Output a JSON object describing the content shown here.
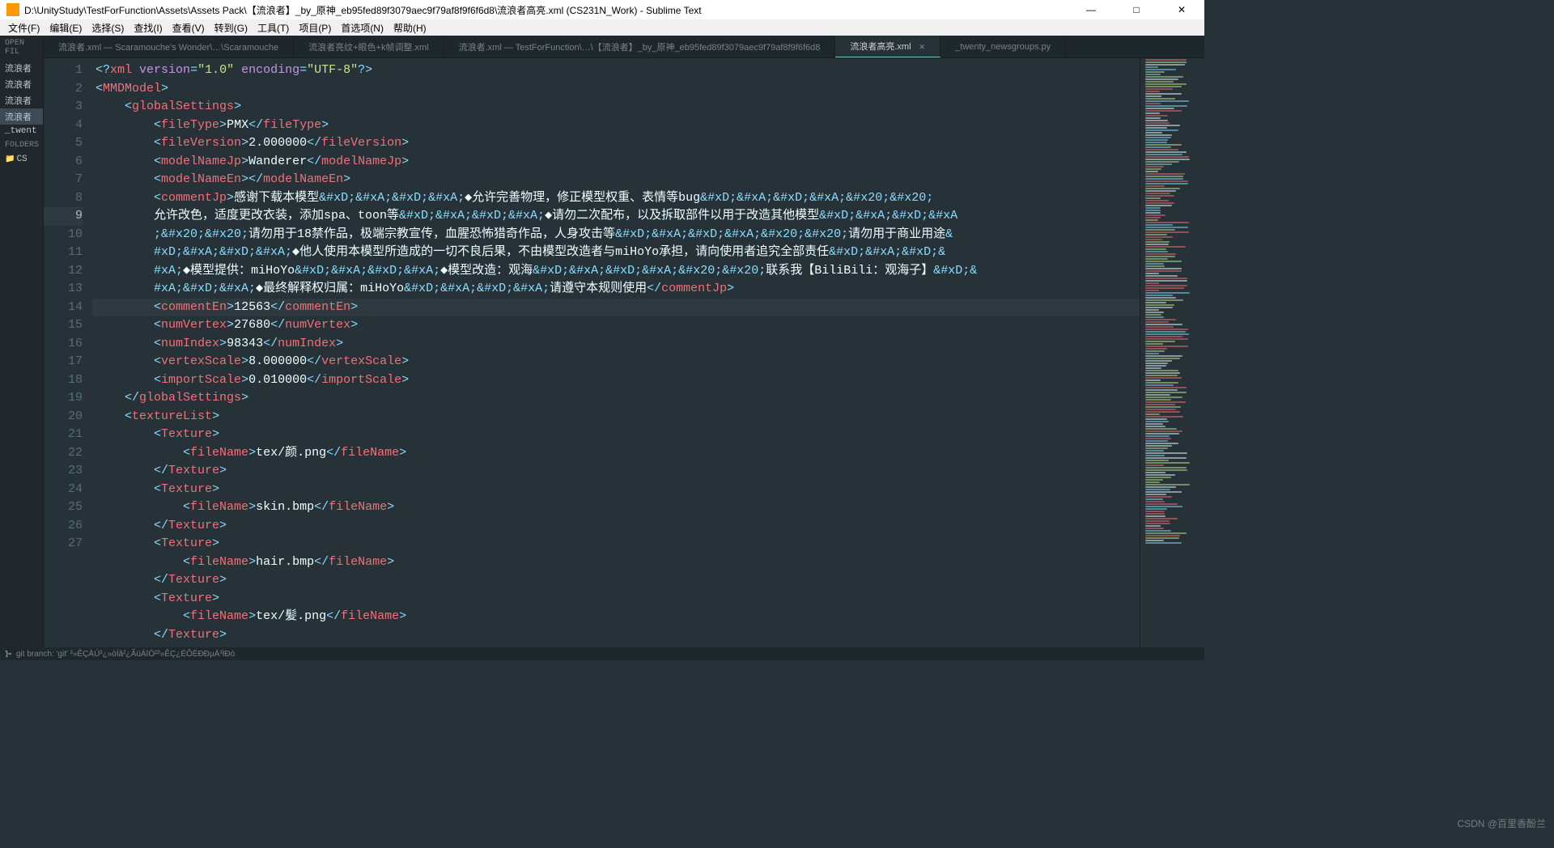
{
  "window": {
    "title": "D:\\UnityStudy\\TestForFunction\\Assets\\Assets Pack\\【流浪者】_by_原神_eb95fed89f3079aec9f79af8f9f6f6d8\\流浪者高亮.xml (CS231N_Work) - Sublime Text"
  },
  "menus": [
    "文件(F)",
    "编辑(E)",
    "选择(S)",
    "查找(I)",
    "查看(V)",
    "转到(G)",
    "工具(T)",
    "项目(P)",
    "首选项(N)",
    "帮助(H)"
  ],
  "sidebar": {
    "open_files_label": "OPEN FIL",
    "open_files": [
      "流浪者",
      "流浪者",
      "流浪者",
      "流浪者",
      "_twent"
    ],
    "folders_label": "FOLDERS",
    "folders": [
      "CS"
    ]
  },
  "tabs": [
    {
      "label": "流浪者.xml — Scaramouche's Wonder\\…\\Scaramouche",
      "active": false
    },
    {
      "label": "流浪者亮纹+眼色+k帧调整.xml",
      "active": false
    },
    {
      "label": "流浪者.xml — TestForFunction\\…\\【流浪者】_by_原神_eb95fed89f3079aec9f79af8f9f6f6d8",
      "active": false
    },
    {
      "label": "流浪者高亮.xml",
      "active": true,
      "close": "×"
    },
    {
      "label": "_twenty_newsgroups.py",
      "active": false
    }
  ],
  "editor": {
    "current_line": 9,
    "lines": [
      {
        "n": 1,
        "html": "<span class='p'>&lt;?</span><span class='pitag'>xml</span> <span class='attr'>version</span><span class='p'>=</span><span class='str'>\"1.0\"</span> <span class='attr'>encoding</span><span class='p'>=</span><span class='str'>\"UTF-8\"</span><span class='p'>?&gt;</span>"
      },
      {
        "n": 2,
        "html": "<span class='p'>&lt;</span><span class='tag'>MMDModel</span><span class='p'>&gt;</span>"
      },
      {
        "n": 3,
        "html": "    <span class='p'>&lt;</span><span class='tag'>globalSettings</span><span class='p'>&gt;</span>"
      },
      {
        "n": 4,
        "html": "        <span class='p'>&lt;</span><span class='tag'>fileType</span><span class='p'>&gt;</span><span class='txt'>PMX</span><span class='p'>&lt;/</span><span class='tag'>fileType</span><span class='p'>&gt;</span>"
      },
      {
        "n": 5,
        "html": "        <span class='p'>&lt;</span><span class='tag'>fileVersion</span><span class='p'>&gt;</span><span class='txt'>2.000000</span><span class='p'>&lt;/</span><span class='tag'>fileVersion</span><span class='p'>&gt;</span>"
      },
      {
        "n": 6,
        "html": "        <span class='p'>&lt;</span><span class='tag'>modelNameJp</span><span class='p'>&gt;</span><span class='txt'>Wanderer</span><span class='p'>&lt;/</span><span class='tag'>modelNameJp</span><span class='p'>&gt;</span>"
      },
      {
        "n": 7,
        "html": "        <span class='p'>&lt;</span><span class='tag'>modelNameEn</span><span class='p'>&gt;&lt;/</span><span class='tag'>modelNameEn</span><span class='p'>&gt;</span>"
      },
      {
        "n": 8,
        "html": "        <span class='p'>&lt;</span><span class='tag'>commentJp</span><span class='p'>&gt;</span><span class='txt'>感谢下载本模型</span><span class='ent'>&amp;#xD;&amp;#xA;&amp;#xD;&amp;#xA;</span><span class='txt'>◆允许完善物理，修正模型权重、表情等bug</span><span class='ent'>&amp;#xD;&amp;#xA;&amp;#xD;&amp;#xA;&amp;#x20;&amp;#x20;</span>\n        <span class='txt'>允许改色，适度更改衣装，添加spa、toon等</span><span class='ent'>&amp;#xD;&amp;#xA;&amp;#xD;&amp;#xA;</span><span class='txt'>◆请勿二次配布，以及拆取部件以用于改造其他模型</span><span class='ent'>&amp;#xD;&amp;#xA;&amp;#xD;&amp;#xA</span>\n        <span class='ent'>;&amp;#x20;&amp;#x20;</span><span class='txt'>请勿用于18禁作品，极端宗教宣传，血腥恐怖猎奇作品，人身攻击等</span><span class='ent'>&amp;#xD;&amp;#xA;&amp;#xD;&amp;#xA;&amp;#x20;&amp;#x20;</span><span class='txt'>请勿用于商业用途</span><span class='ent'>&amp;</span>\n        <span class='ent'>#xD;&amp;#xA;&amp;#xD;&amp;#xA;</span><span class='txt'>◆他人使用本模型所造成的一切不良后果，不由模型改造者与miHoYo承担，请向使用者追究全部责任</span><span class='ent'>&amp;#xD;&amp;#xA;&amp;#xD;&amp;</span>\n        <span class='ent'>#xA;</span><span class='txt'>◆模型提供：miHoYo</span><span class='ent'>&amp;#xD;&amp;#xA;&amp;#xD;&amp;#xA;</span><span class='txt'>◆模型改造：观海</span><span class='ent'>&amp;#xD;&amp;#xA;&amp;#xD;&amp;#xA;&amp;#x20;&amp;#x20;</span><span class='txt'>联系我【BiliBili：观海子】</span><span class='ent'>&amp;#xD;&amp;</span>\n        <span class='ent'>#xA;&amp;#xD;&amp;#xA;</span><span class='txt'>◆最终解释权归属：miHoYo</span><span class='ent'>&amp;#xD;&amp;#xA;&amp;#xD;&amp;#xA;</span><span class='txt'>请遵守本规则使用</span><span class='p'>&lt;/</span><span class='tag'>commentJp</span><span class='p'>&gt;</span>"
      },
      {
        "n": 9,
        "html": "        <span class='p'>&lt;</span><span class='tag'>commentEn</span><span class='p'>&gt;</span><span class='txt'>12563</span><span class='p'>&lt;/</span><span class='tag'>commentEn</span><span class='p'>&gt;</span>"
      },
      {
        "n": 10,
        "html": "        <span class='p'>&lt;</span><span class='tag'>numVertex</span><span class='p'>&gt;</span><span class='txt'>27680</span><span class='p'>&lt;/</span><span class='tag'>numVertex</span><span class='p'>&gt;</span>"
      },
      {
        "n": 11,
        "html": "        <span class='p'>&lt;</span><span class='tag'>numIndex</span><span class='p'>&gt;</span><span class='txt'>98343</span><span class='p'>&lt;/</span><span class='tag'>numIndex</span><span class='p'>&gt;</span>"
      },
      {
        "n": 12,
        "html": "        <span class='p'>&lt;</span><span class='tag'>vertexScale</span><span class='p'>&gt;</span><span class='txt'>8.000000</span><span class='p'>&lt;/</span><span class='tag'>vertexScale</span><span class='p'>&gt;</span>"
      },
      {
        "n": 13,
        "html": "        <span class='p'>&lt;</span><span class='tag'>importScale</span><span class='p'>&gt;</span><span class='txt'>0.010000</span><span class='p'>&lt;/</span><span class='tag'>importScale</span><span class='p'>&gt;</span>"
      },
      {
        "n": 14,
        "html": "    <span class='p'>&lt;/</span><span class='tag'>globalSettings</span><span class='p'>&gt;</span>"
      },
      {
        "n": 15,
        "html": "    <span class='p'>&lt;</span><span class='tag'>textureList</span><span class='p'>&gt;</span>"
      },
      {
        "n": 16,
        "html": "        <span class='p'>&lt;</span><span class='tag'>Texture</span><span class='p'>&gt;</span>"
      },
      {
        "n": 17,
        "html": "            <span class='p'>&lt;</span><span class='tag'>fileName</span><span class='p'>&gt;</span><span class='txt'>tex/颜.png</span><span class='p'>&lt;/</span><span class='tag'>fileName</span><span class='p'>&gt;</span>"
      },
      {
        "n": 18,
        "html": "        <span class='p'>&lt;/</span><span class='tag'>Texture</span><span class='p'>&gt;</span>"
      },
      {
        "n": 19,
        "html": "        <span class='p'>&lt;</span><span class='tag'>Texture</span><span class='p'>&gt;</span>"
      },
      {
        "n": 20,
        "html": "            <span class='p'>&lt;</span><span class='tag'>fileName</span><span class='p'>&gt;</span><span class='txt'>skin.bmp</span><span class='p'>&lt;/</span><span class='tag'>fileName</span><span class='p'>&gt;</span>"
      },
      {
        "n": 21,
        "html": "        <span class='p'>&lt;/</span><span class='tag'>Texture</span><span class='p'>&gt;</span>"
      },
      {
        "n": 22,
        "html": "        <span class='p'>&lt;</span><span class='tag'>Texture</span><span class='p'>&gt;</span>"
      },
      {
        "n": 23,
        "html": "            <span class='p'>&lt;</span><span class='tag'>fileName</span><span class='p'>&gt;</span><span class='txt'>hair.bmp</span><span class='p'>&lt;/</span><span class='tag'>fileName</span><span class='p'>&gt;</span>"
      },
      {
        "n": 24,
        "html": "        <span class='p'>&lt;/</span><span class='tag'>Texture</span><span class='p'>&gt;</span>"
      },
      {
        "n": 25,
        "html": "        <span class='p'>&lt;</span><span class='tag'>Texture</span><span class='p'>&gt;</span>"
      },
      {
        "n": 26,
        "html": "            <span class='p'>&lt;</span><span class='tag'>fileName</span><span class='p'>&gt;</span><span class='txt'>tex/髪.png</span><span class='p'>&lt;/</span><span class='tag'>fileName</span><span class='p'>&gt;</span>"
      },
      {
        "n": 27,
        "html": "        <span class='p'>&lt;/</span><span class='tag'>Texture</span><span class='p'>&gt;</span>"
      }
    ]
  },
  "statusbar": {
    "git": "git branch: 'git' ²»ÊÇÄÚ²¿»òÍâ²¿ÃüÁîÒ²²»ÊÇ¿ÉÔËÐÐµÄ³ÌÐò"
  },
  "watermark": "CSDN @百里香酚兰"
}
